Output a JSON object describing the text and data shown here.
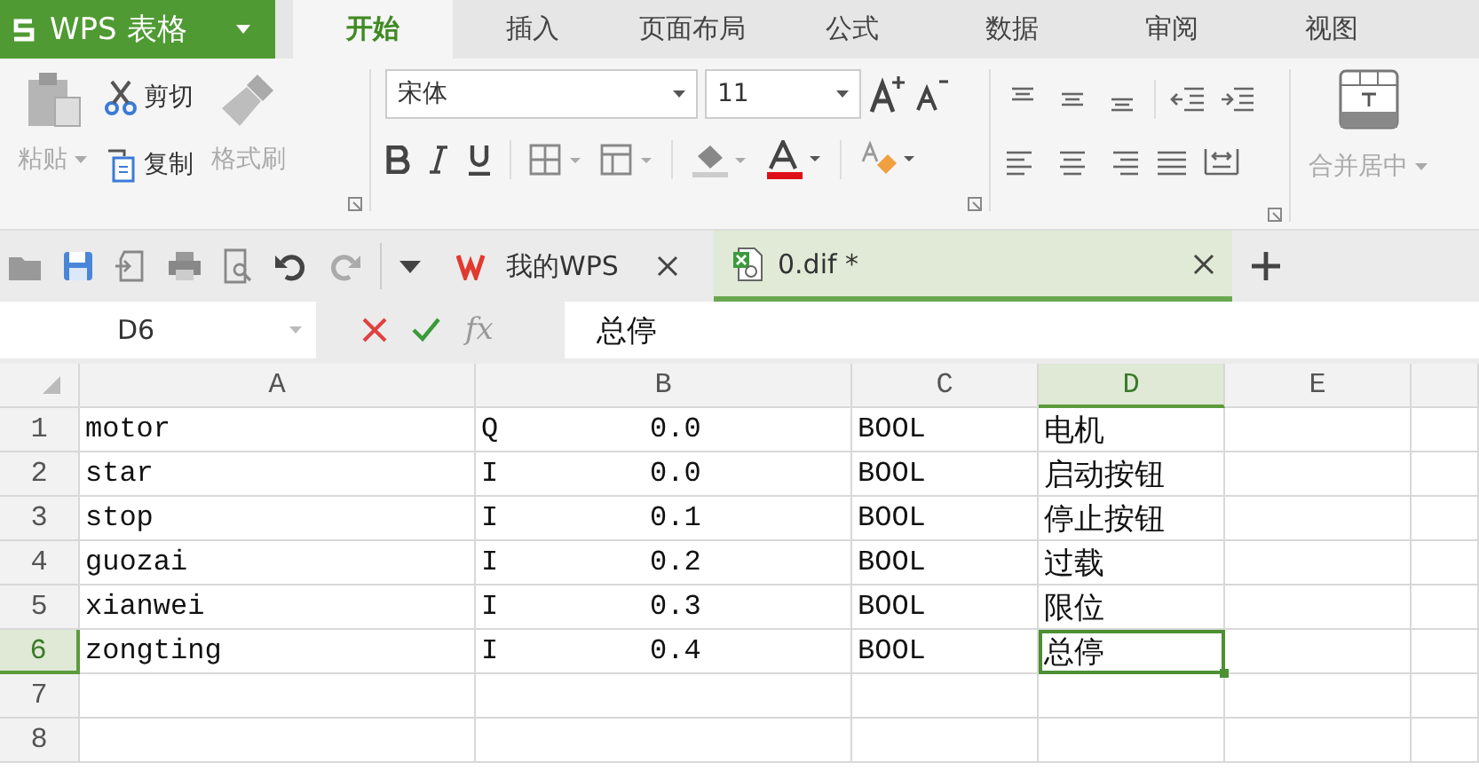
{
  "app": {
    "name": "WPS 表格"
  },
  "ribbon_tabs": [
    {
      "label": "开始",
      "selected": true
    },
    {
      "label": "插入",
      "selected": false
    },
    {
      "label": "页面布局",
      "selected": false
    },
    {
      "label": "公式",
      "selected": false
    },
    {
      "label": "数据",
      "selected": false
    },
    {
      "label": "审阅",
      "selected": false
    },
    {
      "label": "视图",
      "selected": false
    }
  ],
  "clipboard": {
    "paste": {
      "label": "粘贴",
      "disabled": true
    },
    "cut": {
      "label": "剪切",
      "disabled": false
    },
    "copy": {
      "label": "复制",
      "disabled": false
    },
    "format_painter": {
      "label": "格式刷",
      "disabled": true
    }
  },
  "font": {
    "name": "宋体",
    "size": "11"
  },
  "merge": {
    "label": "合并居中"
  },
  "doc_tabs": [
    {
      "label": "我的WPS",
      "selected": false,
      "kind": "home"
    },
    {
      "label": "0.dif *",
      "selected": true,
      "kind": "sheet"
    }
  ],
  "formula_bar": {
    "cell_ref": "D6",
    "fx": "fx",
    "value": "总停"
  },
  "sheet": {
    "columns": [
      {
        "label": "A",
        "selected": false
      },
      {
        "label": "B",
        "selected": false
      },
      {
        "label": "C",
        "selected": false
      },
      {
        "label": "D",
        "selected": true
      },
      {
        "label": "E",
        "selected": false
      }
    ],
    "rows": [
      {
        "label": "1",
        "selected": false,
        "cells": [
          "motor",
          [
            "Q",
            "0.0"
          ],
          "BOOL",
          "电机",
          ""
        ]
      },
      {
        "label": "2",
        "selected": false,
        "cells": [
          "star",
          [
            "I",
            "0.0"
          ],
          "BOOL",
          "启动按钮",
          ""
        ]
      },
      {
        "label": "3",
        "selected": false,
        "cells": [
          "stop",
          [
            "I",
            "0.1"
          ],
          "BOOL",
          "停止按钮",
          ""
        ]
      },
      {
        "label": "4",
        "selected": false,
        "cells": [
          "guozai",
          [
            "I",
            "0.2"
          ],
          "BOOL",
          "过载",
          ""
        ]
      },
      {
        "label": "5",
        "selected": false,
        "cells": [
          "xianwei",
          [
            "I",
            "0.3"
          ],
          "BOOL",
          "限位",
          ""
        ]
      },
      {
        "label": "6",
        "selected": true,
        "cells": [
          "zongting",
          [
            "I",
            "0.4"
          ],
          "BOOL",
          "总停",
          ""
        ]
      },
      {
        "label": "7",
        "selected": false,
        "cells": [
          "",
          "",
          "",
          "",
          ""
        ]
      },
      {
        "label": "8",
        "selected": false,
        "cells": [
          "",
          "",
          "",
          "",
          ""
        ]
      }
    ]
  }
}
